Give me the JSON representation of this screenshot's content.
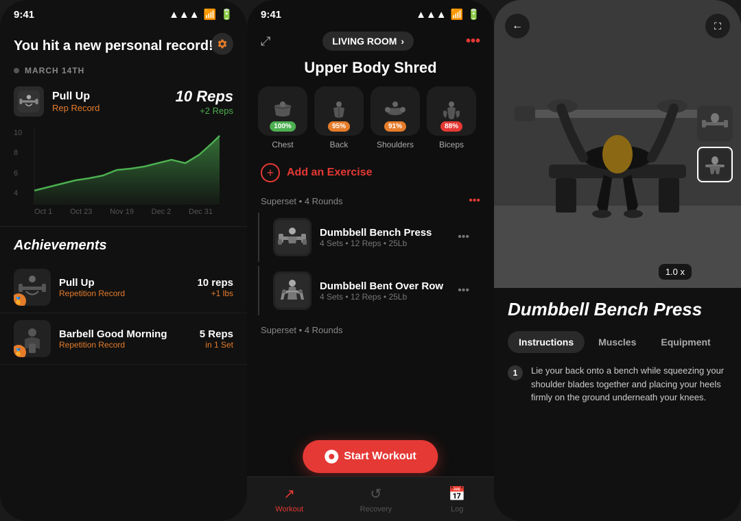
{
  "panel1": {
    "status_time": "9:41",
    "pr_banner": "You hit a new personal record!",
    "date": "MARCH 14TH",
    "exercise_name": "Pull Up",
    "exercise_type": "Rep Record",
    "record_value": "10",
    "record_unit": "Reps",
    "record_change": "+2 Reps",
    "chart_dates": [
      "Oct 1",
      "Oct 23",
      "Nov 19",
      "Dec 2",
      "Dec 31"
    ],
    "chart_y_labels": [
      "10",
      "8",
      "6",
      "4"
    ],
    "achievements_title": "Achievements",
    "achievements": [
      {
        "name": "Pull Up",
        "type": "Repetition Record",
        "value": "10 reps",
        "change": "+1 lbs",
        "icon": "🏋"
      },
      {
        "name": "Barbell Good Morning",
        "type": "Repetition Record",
        "value": "5 Reps",
        "change": "in 1 Set",
        "icon": "🏋"
      }
    ]
  },
  "panel2": {
    "status_time": "9:41",
    "location": "LIVING ROOM",
    "workout_title": "Upper Body Shred",
    "muscles": [
      {
        "name": "Chest",
        "pct": "100%",
        "color": "pct-green",
        "icon": "🫁"
      },
      {
        "name": "Back",
        "pct": "95%",
        "color": "pct-orange",
        "icon": "🔙"
      },
      {
        "name": "Shoulders",
        "pct": "91%",
        "color": "pct-orange",
        "icon": "💪"
      },
      {
        "name": "Biceps",
        "pct": "88%",
        "color": "pct-red",
        "icon": "💪"
      }
    ],
    "add_exercise_label": "Add an Exercise",
    "superset1": {
      "label": "Superset",
      "rounds": "4 Rounds",
      "exercises": [
        {
          "name": "Dumbbell Bench Press",
          "details": "4 Sets • 12 Reps • 25Lb",
          "icon": "🏋"
        },
        {
          "name": "Dumbbell Bent Over Row",
          "details": "4 Sets • 12 Reps • 25Lb",
          "icon": "🏃"
        }
      ]
    },
    "superset2": {
      "label": "Superset",
      "rounds": "4 Rounds"
    },
    "start_workout_label": "Start Workout",
    "tabs": [
      {
        "label": "Workout",
        "active": true
      },
      {
        "label": "Recovery",
        "active": false
      },
      {
        "label": "Log",
        "active": false
      }
    ]
  },
  "panel3": {
    "back_icon": "←",
    "expand_icon": "⛶",
    "exercise_title": "Dumbbell Bench Press",
    "speed_label": "1.0 x",
    "tabs": [
      {
        "label": "Instructions",
        "active": true
      },
      {
        "label": "Muscles",
        "active": false
      },
      {
        "label": "Equipment",
        "active": false
      }
    ],
    "instructions": [
      {
        "num": "1",
        "text": "Lie your back onto a bench while squeezing your shoulder blades together and placing your heels firmly on the ground underneath your knees."
      }
    ]
  }
}
